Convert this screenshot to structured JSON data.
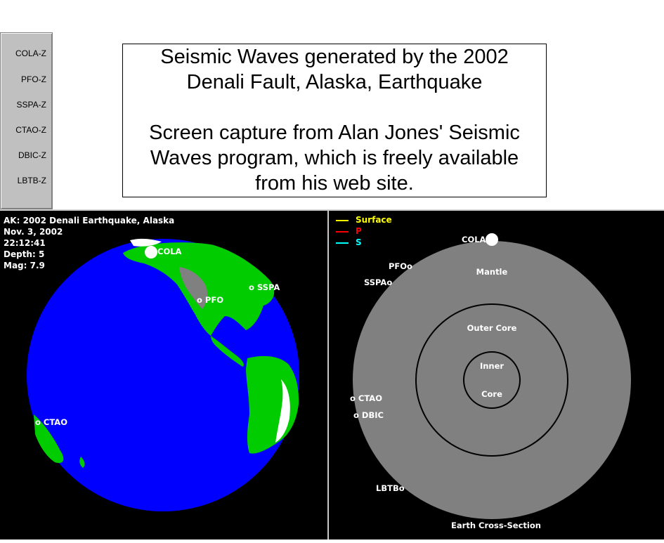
{
  "stations": {
    "buttons": [
      "COLA-Z",
      "PFO-Z",
      "SSPA-Z",
      "CTAO-Z",
      "DBIC-Z",
      "LBTB-Z"
    ]
  },
  "title_box": {
    "line1": "Seismic Waves generated by the 2002",
    "line2": "Denali Fault, Alaska, Earthquake",
    "line3": "Screen capture from Alan Jones' Seismic",
    "line4": "Waves program, which is freely available",
    "line5": "from his web site."
  },
  "quake_info": {
    "name": "AK: 2002 Denali Earthquake, Alaska",
    "date": "Nov. 3, 2002",
    "time": "22:12:41",
    "depth": "Depth:   5",
    "mag": "Mag:  7.9"
  },
  "globe": {
    "stations": {
      "cola": "COLA",
      "pfo": "o PFO",
      "sspa": "o SSPA",
      "ctao": "o CTAO"
    },
    "colors": {
      "ocean": "#0000ff",
      "land": "#00cc00",
      "mountain": "#808080",
      "ice": "#ffffff"
    }
  },
  "legend": {
    "items": [
      {
        "label": "Surface",
        "color": "#ffff00"
      },
      {
        "label": "P",
        "color": "#ff0000"
      },
      {
        "label": "S",
        "color": "#00ffff"
      }
    ]
  },
  "cross_section": {
    "caption": "Earth Cross-Section",
    "layers": {
      "mantle": "Mantle",
      "outer_core": "Outer Core",
      "inner_1": "Inner",
      "inner_2": "Core"
    },
    "stations": {
      "cola": "COLA",
      "pfo": "PFOo",
      "sspa": "SSPAo",
      "ctao": "o CTAO",
      "dbic": "o DBIC",
      "lbtb": "LBTBo"
    },
    "colors": {
      "body": "#808080",
      "outline": "#000000"
    }
  }
}
